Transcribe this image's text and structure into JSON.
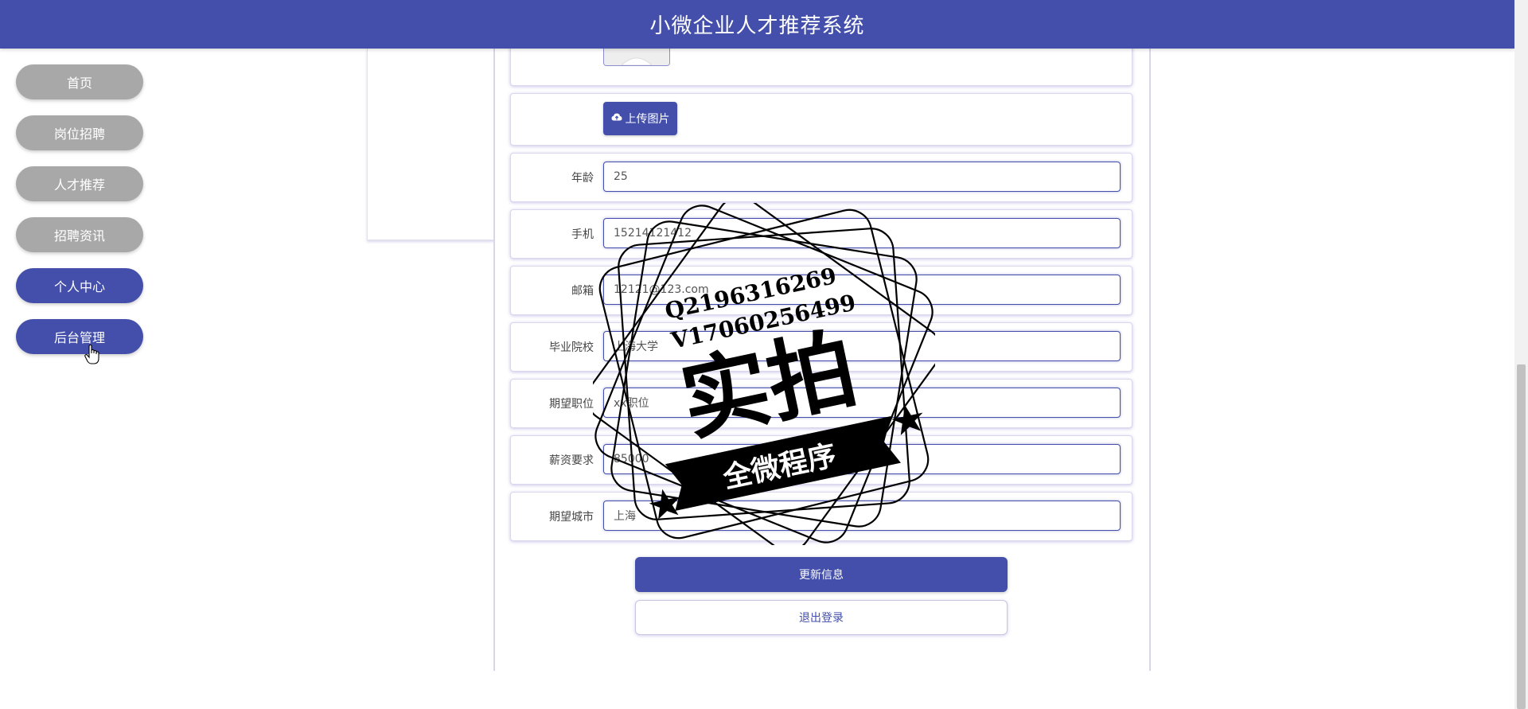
{
  "header": {
    "title": "小微企业人才推荐系统"
  },
  "nav": [
    {
      "label": "首页",
      "active": false
    },
    {
      "label": "岗位招聘",
      "active": false
    },
    {
      "label": "人才推荐",
      "active": false
    },
    {
      "label": "招聘资讯",
      "active": false
    },
    {
      "label": "个人中心",
      "active": true
    },
    {
      "label": "后台管理",
      "active": true
    }
  ],
  "form": {
    "upload_label": "上传图片",
    "fields": [
      {
        "label": "年龄",
        "value": "25"
      },
      {
        "label": "手机",
        "value": "15214121412"
      },
      {
        "label": "邮箱",
        "value": "12121@123.com"
      },
      {
        "label": "毕业院校",
        "value": "上海大学"
      },
      {
        "label": "期望职位",
        "value": "xx职位"
      },
      {
        "label": "薪资要求",
        "value": "85000"
      },
      {
        "label": "期望城市",
        "value": "上海"
      }
    ]
  },
  "actions": {
    "update_label": "更新信息",
    "logout_label": "退出登录"
  },
  "watermark": {
    "qq": "Q2196316269",
    "wechat": "V17060256499",
    "main_text": "实拍",
    "banner_text": "全微程序"
  },
  "colors": {
    "primary": "#434fab",
    "nav_inactive": "#a8a8a8"
  },
  "icons": {
    "upload": "cloud-upload-icon",
    "cursor": "hand-pointer-icon",
    "avatar": "profile-photo"
  }
}
